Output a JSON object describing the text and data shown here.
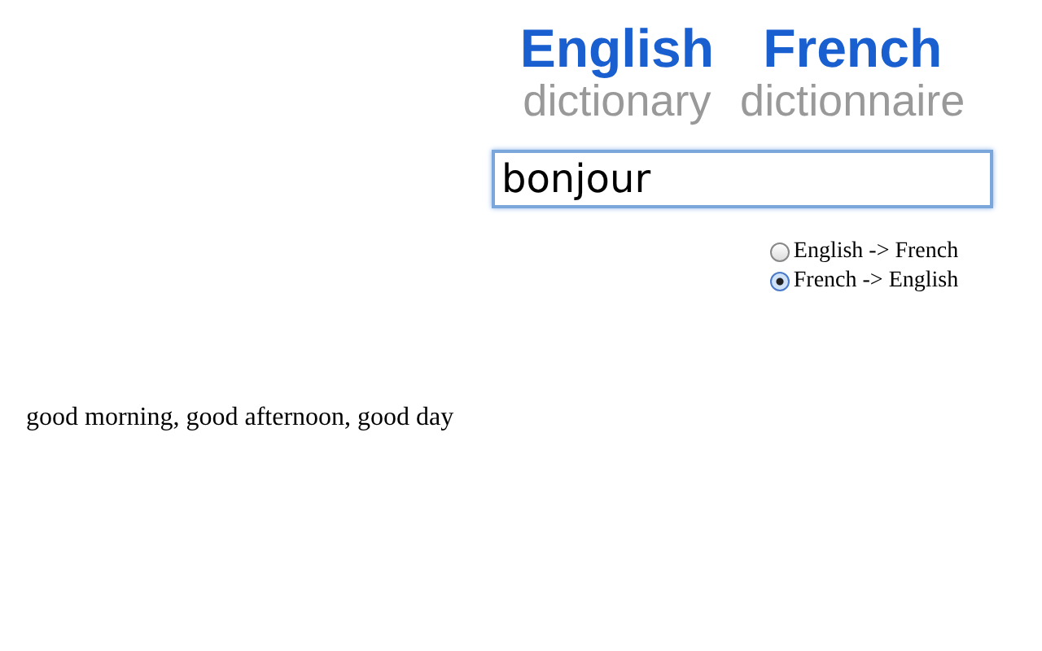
{
  "header": [
    {
      "title": "English",
      "subtitle": "dictionary"
    },
    {
      "title": "French",
      "subtitle": "dictionnaire"
    }
  ],
  "search": {
    "value": "bonjour"
  },
  "directions": [
    {
      "label": "English -> French",
      "selected": false
    },
    {
      "label": "French -> English",
      "selected": true
    }
  ],
  "result": "good morning, good afternoon, good day"
}
